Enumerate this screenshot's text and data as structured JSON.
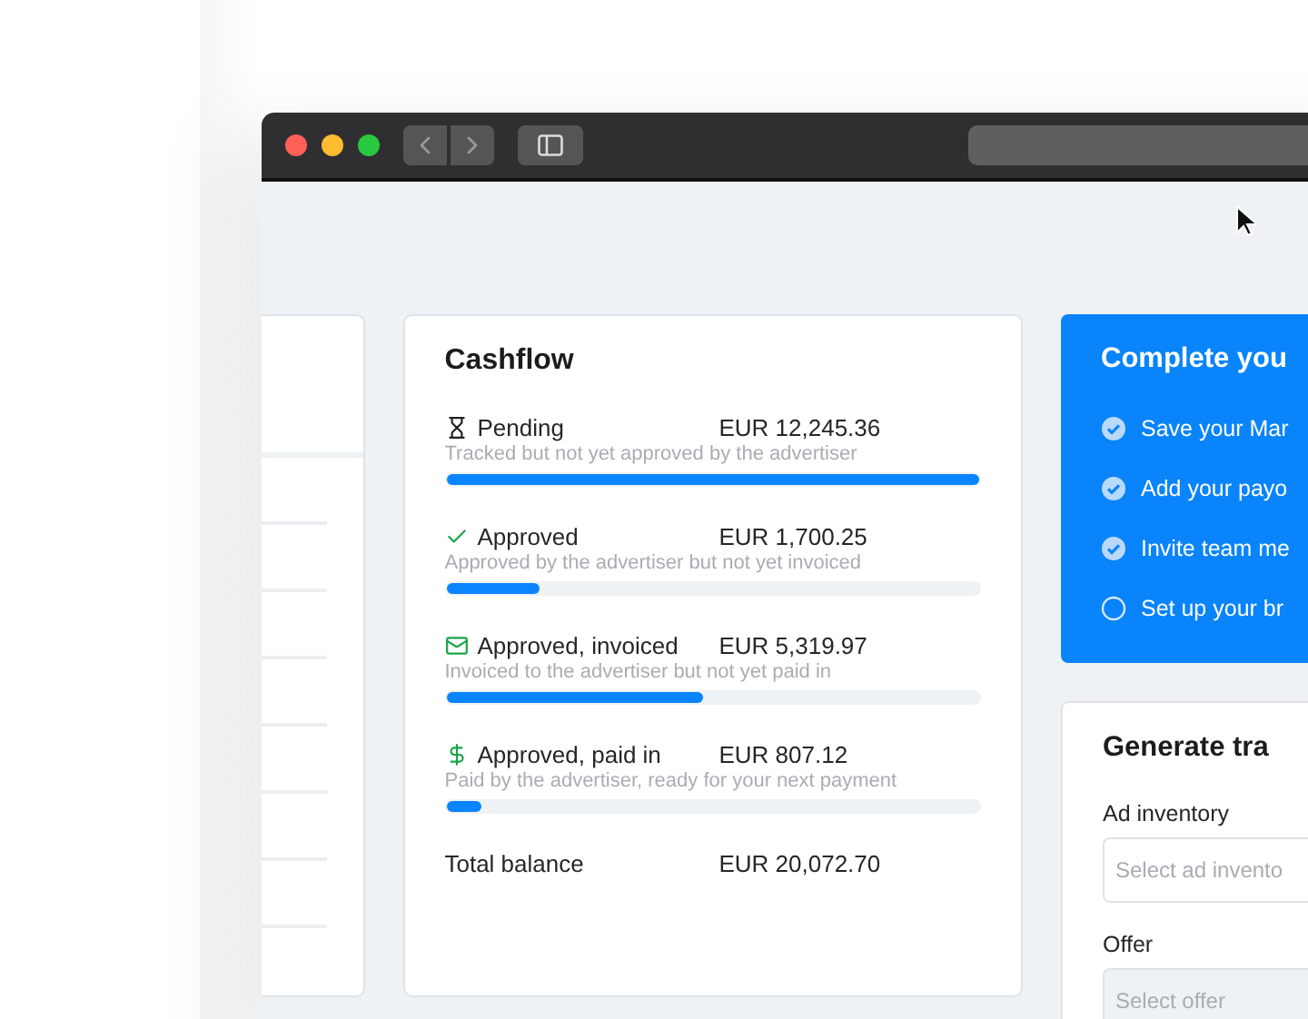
{
  "cashflow": {
    "title": "Cashflow",
    "items": [
      {
        "label": "Pending",
        "amount": "EUR 12,245.36",
        "description": "Tracked but not yet approved by the advertiser",
        "level": 1
      },
      {
        "label": "Approved",
        "amount": "EUR 1,700.25",
        "description": "Approved by the advertiser but not yet invoiced",
        "level": 0.175
      },
      {
        "label": "Approved, invoiced",
        "amount": "EUR 5,319.97",
        "description": "Invoiced to the advertiser but not yet paid in",
        "level": 0.48
      },
      {
        "label": "Approved, paid in",
        "amount": "EUR 807.12",
        "description": "Paid by the advertiser, ready for your next payment",
        "level": 0.066
      }
    ],
    "total": {
      "label": "Total balance",
      "amount": "EUR 20,072.70"
    }
  },
  "checklist": {
    "title": "Complete you",
    "items": [
      {
        "label": "Save your Mar",
        "checked": true
      },
      {
        "label": "Add your payo",
        "checked": true
      },
      {
        "label": "Invite team me",
        "checked": true
      },
      {
        "label": "Set up your br",
        "checked": false
      }
    ]
  },
  "generator": {
    "title": "Generate tra",
    "fields": [
      {
        "label": "Ad inventory",
        "placeholder": "Select ad invento"
      },
      {
        "label": "Offer",
        "placeholder": "Select offer"
      }
    ]
  }
}
